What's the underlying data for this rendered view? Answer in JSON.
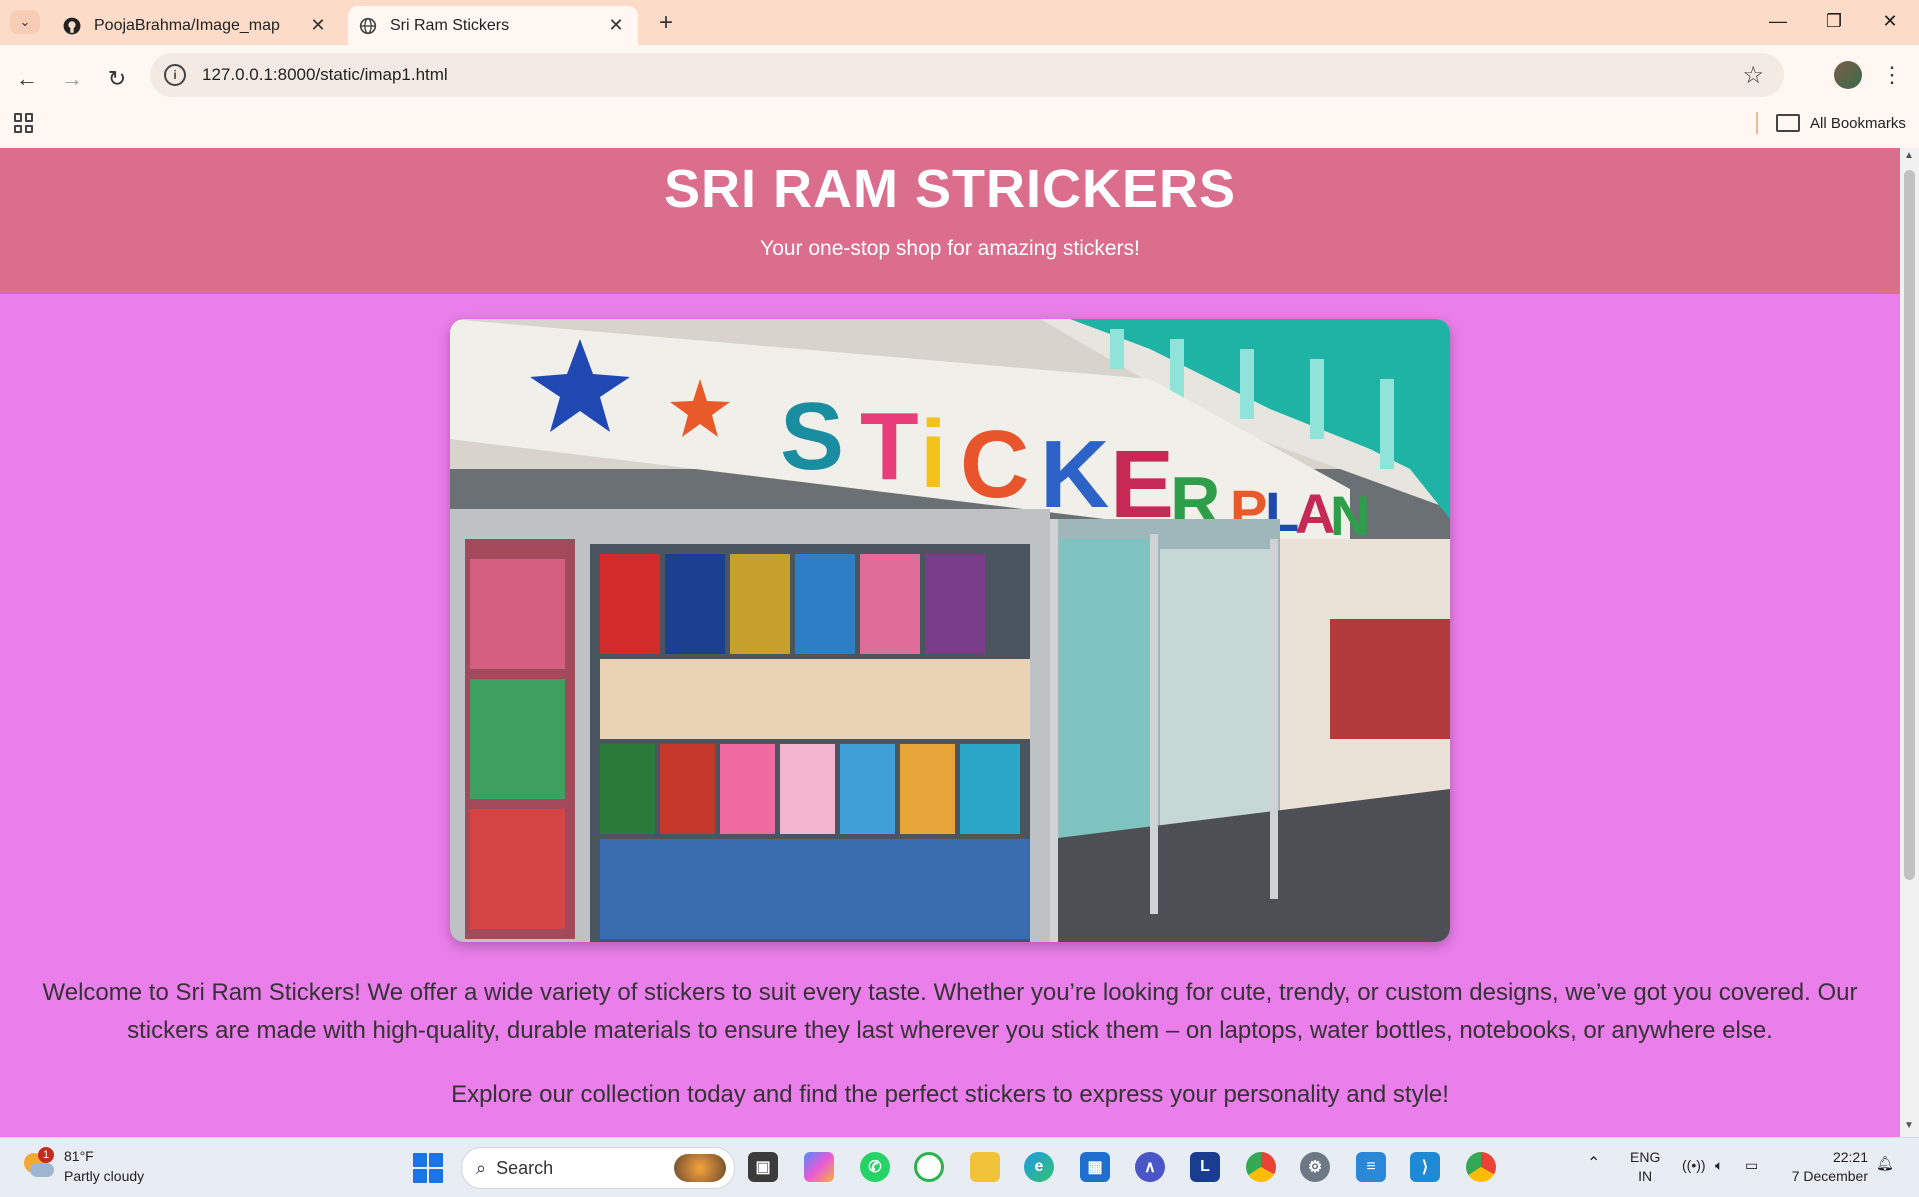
{
  "browser": {
    "tabs": [
      {
        "title": "PoojaBrahma/Image_map",
        "favicon": "github-icon"
      },
      {
        "title": "Sri Ram Stickers",
        "favicon": "globe-icon"
      }
    ],
    "url": "127.0.0.1:8000/static/imap1.html",
    "bookmarks_label": "All Bookmarks"
  },
  "page": {
    "title": "SRI RAM STRICKERS",
    "tagline": "Your one-stop shop for amazing stickers!",
    "hero_image": {
      "description_icon": "sticker-shop-photo",
      "sign_text": "STiCKER PLANET"
    },
    "paragraph1": "Welcome to Sri Ram Stickers! We offer a wide variety of stickers to suit every taste. Whether you’re looking for cute, trendy, or custom designs, we’ve got you covered. Our stickers are made with high-quality, durable materials to ensure they last wherever you stick them – on laptops, water bottles, notebooks, or anywhere else.",
    "paragraph2": "Explore our collection today and find the perfect stickers to express your personality and style!",
    "colors": {
      "header_bg": "#dc6e8d",
      "page_bg": "#ea7eea"
    }
  },
  "taskbar": {
    "weather": {
      "temp": "81°F",
      "condition": "Partly cloudy",
      "badge": "1"
    },
    "search_placeholder": "Search",
    "pinned": [
      "task-view-icon",
      "copilot-icon",
      "whatsapp-icon",
      "refresh-app-icon",
      "file-explorer-icon",
      "edge-icon",
      "store-icon",
      "vpn-icon",
      "l-app-icon",
      "chrome-icon",
      "settings-icon",
      "notepad-icon",
      "vscode-icon",
      "chrome-profile-icon"
    ],
    "lang_top": "ENG",
    "lang_bottom": "IN",
    "time": "22:21",
    "date": "7 December"
  }
}
